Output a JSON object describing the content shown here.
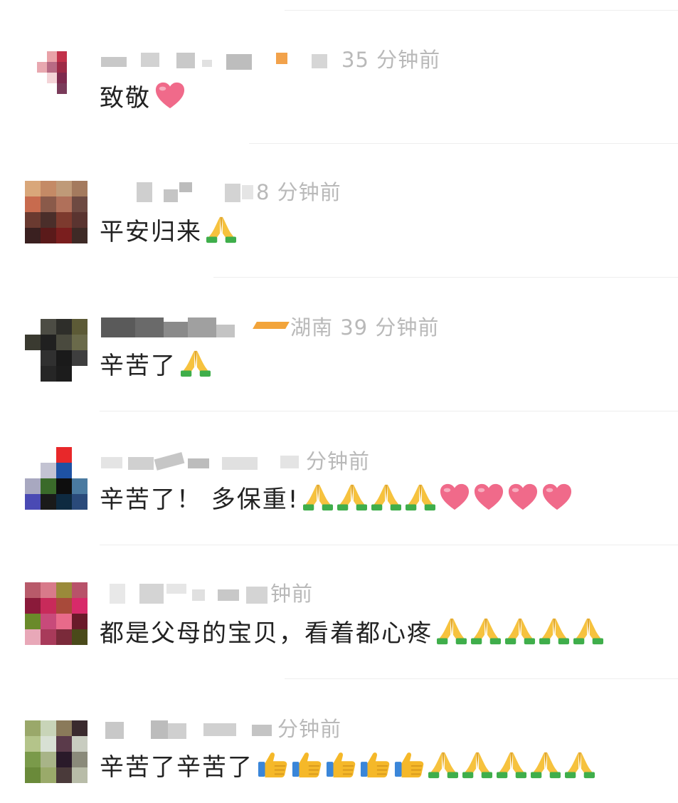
{
  "comments": [
    {
      "meta": "35 分钟前",
      "text": "致敬",
      "emojis": [
        "heart-icon"
      ]
    },
    {
      "meta": "8 分钟前",
      "text": "平安归来",
      "emojis": [
        "pray-icon"
      ]
    },
    {
      "meta": "湖南 39 分钟前",
      "text": "辛苦了",
      "emojis": [
        "pray-icon"
      ]
    },
    {
      "meta": "分钟前",
      "text": "辛苦了！ 多保重!",
      "emojis": [
        "pray-icon",
        "pray-icon",
        "pray-icon",
        "pray-icon",
        "heart-icon",
        "heart-icon",
        "heart-icon",
        "heart-icon"
      ]
    },
    {
      "meta": "钟前",
      "text": "都是父母的宝贝，看着都心疼",
      "emojis": [
        "pray-icon",
        "pray-icon",
        "pray-icon",
        "pray-icon",
        "pray-icon"
      ]
    },
    {
      "meta": "分钟前",
      "text": "辛苦了辛苦了",
      "emojis": [
        "thumbs-up-icon",
        "thumbs-up-icon",
        "thumbs-up-icon",
        "thumbs-up-icon",
        "thumbs-up-icon",
        "pray-icon",
        "pray-icon",
        "pray-icon",
        "pray-icon",
        "pray-icon"
      ]
    }
  ],
  "colors": {
    "meta_text": "#b9b9b9",
    "content_text": "#222222",
    "divider": "#eeeeee",
    "heart": "#f06a8a",
    "pray_hand": "#f6c23e",
    "pray_sleeve": "#3fae4b",
    "thumb": "#f5b829",
    "thumb_sleeve": "#3a86d9"
  }
}
